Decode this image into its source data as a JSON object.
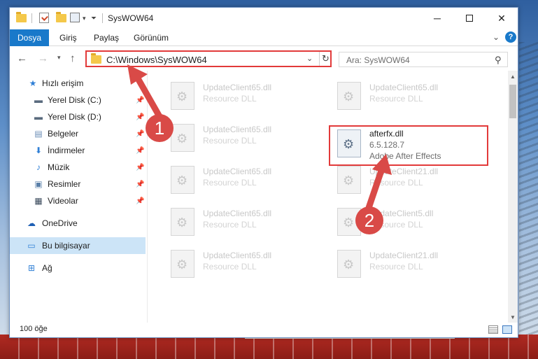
{
  "window": {
    "title": "SysWOW64",
    "minimize_glyph": "─",
    "close_glyph": "✕"
  },
  "ribbon": {
    "tabs": [
      "Dosya",
      "Giriş",
      "Paylaş",
      "Görünüm"
    ],
    "help": "?"
  },
  "address": {
    "path": "C:\\Windows\\SysWOW64",
    "search_placeholder": "Ara: SysWOW64"
  },
  "sidebar": {
    "items": [
      {
        "label": "Hızlı erişim",
        "icon": "star-icon",
        "pinned": false
      },
      {
        "label": "Yerel Disk (C:)",
        "icon": "drive-icon",
        "pinned": true
      },
      {
        "label": "Yerel Disk (D:)",
        "icon": "drive-icon",
        "pinned": true
      },
      {
        "label": "Belgeler",
        "icon": "documents-icon",
        "pinned": true
      },
      {
        "label": "İndirmeler",
        "icon": "downloads-icon",
        "pinned": true
      },
      {
        "label": "Müzik",
        "icon": "music-icon",
        "pinned": true
      },
      {
        "label": "Resimler",
        "icon": "pictures-icon",
        "pinned": true
      },
      {
        "label": "Videolar",
        "icon": "videos-icon",
        "pinned": true
      },
      {
        "label": "OneDrive",
        "icon": "cloud-icon",
        "pinned": false
      },
      {
        "label": "Bu bilgisayar",
        "icon": "computer-icon",
        "pinned": false,
        "selected": true
      },
      {
        "label": "Ağ",
        "icon": "network-icon",
        "pinned": false
      }
    ]
  },
  "files": [
    {
      "name": "UpdateClient65.dll",
      "desc": "Resource DLL"
    },
    {
      "name": "UpdateClient65.dll",
      "desc": "Resource DLL"
    },
    {
      "name": "UpdateClient65.dll",
      "desc": "Resource DLL"
    },
    {
      "name": "afterfx.dll",
      "version": "6.5.128.7",
      "desc": "Adobe After Effects",
      "highlighted": true
    },
    {
      "name": "UpdateClient65.dll",
      "desc": "Resource DLL"
    },
    {
      "name": "UpdateClient21.dll",
      "desc": "Resource DLL"
    },
    {
      "name": "UpdateClient65.dll",
      "desc": "Resource DLL"
    },
    {
      "name": "UpdateClient5.dll",
      "desc": "Resource DLL"
    },
    {
      "name": "UpdateClient65.dll",
      "desc": "Resource DLL"
    },
    {
      "name": "UpdateClient21.dll",
      "desc": "Resource DLL"
    }
  ],
  "status": {
    "item_count": "100 öğe"
  },
  "annotations": {
    "step1": "1",
    "step2": "2",
    "highlight_color": "#e23a3a",
    "badge_color": "#d94a47"
  },
  "colors": {
    "accent": "#1979ca",
    "selection": "#cce4f7"
  }
}
